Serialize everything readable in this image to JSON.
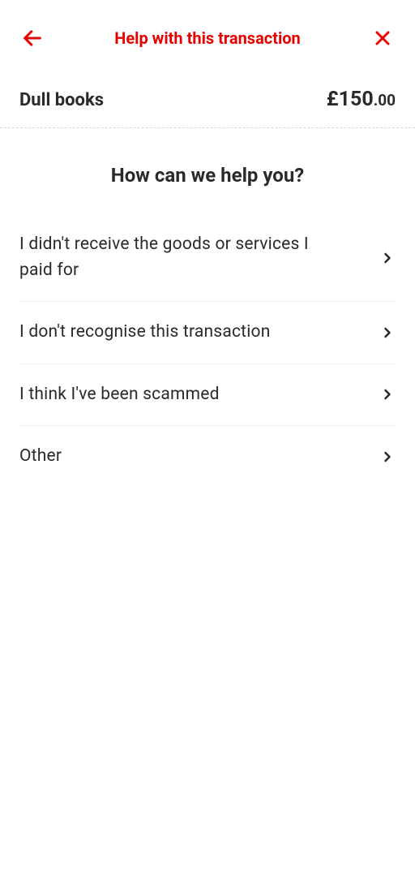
{
  "header": {
    "title": "Help with this transaction",
    "back_icon": "back-arrow-icon",
    "close_icon": "close-icon",
    "brand_color": "#e60000"
  },
  "transaction": {
    "merchant": "Dull books",
    "amount_whole": "£150",
    "amount_decimal": ".00"
  },
  "help": {
    "heading": "How can we help you?"
  },
  "options": [
    {
      "label": "I didn't receive the goods or services I paid for"
    },
    {
      "label": "I don't recognise this transaction"
    },
    {
      "label": "I think I've been scammed"
    },
    {
      "label": "Other"
    }
  ]
}
